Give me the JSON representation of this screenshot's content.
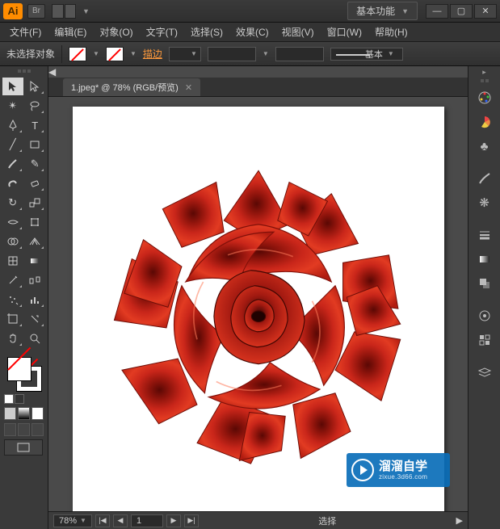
{
  "titlebar": {
    "app_icon_text": "Ai",
    "br_icon_text": "Br",
    "workspace_label": "基本功能"
  },
  "menu": {
    "items": [
      "文件(F)",
      "编辑(E)",
      "对象(O)",
      "文字(T)",
      "选择(S)",
      "效果(C)",
      "视图(V)",
      "窗口(W)",
      "帮助(H)"
    ]
  },
  "controlbar": {
    "selection_label": "未选择对象",
    "stroke_link": "描边",
    "stroke_width": "",
    "stroke_style_label": "基本"
  },
  "document": {
    "tab_title": "1.jpeg* @ 78% (RGB/预览)"
  },
  "statusbar": {
    "zoom": "78%",
    "page": "1",
    "mode": "选择"
  },
  "tools": {
    "left": [
      [
        "selection",
        "direct-selection"
      ],
      [
        "magic-wand",
        "lasso"
      ],
      [
        "pen",
        "type"
      ],
      [
        "line-segment",
        "rectangle"
      ],
      [
        "paintbrush",
        "pencil"
      ],
      [
        "blob-brush",
        "eraser"
      ],
      [
        "rotate",
        "scale"
      ],
      [
        "width",
        "free-transform"
      ],
      [
        "shape-builder",
        "perspective-grid"
      ],
      [
        "mesh",
        "gradient"
      ],
      [
        "eyedropper",
        "blend"
      ],
      [
        "symbol-sprayer",
        "column-graph"
      ],
      [
        "artboard",
        "slice"
      ],
      [
        "hand",
        "zoom"
      ]
    ]
  },
  "right_panels": [
    "color",
    "color-guide",
    "swatches",
    "brushes",
    "symbols",
    "stroke",
    "gradient",
    "transparency",
    "appearance",
    "graphic-styles",
    "layers"
  ],
  "watermark": {
    "cn": "溜溜自学",
    "en": "zixue.3d66.com"
  }
}
